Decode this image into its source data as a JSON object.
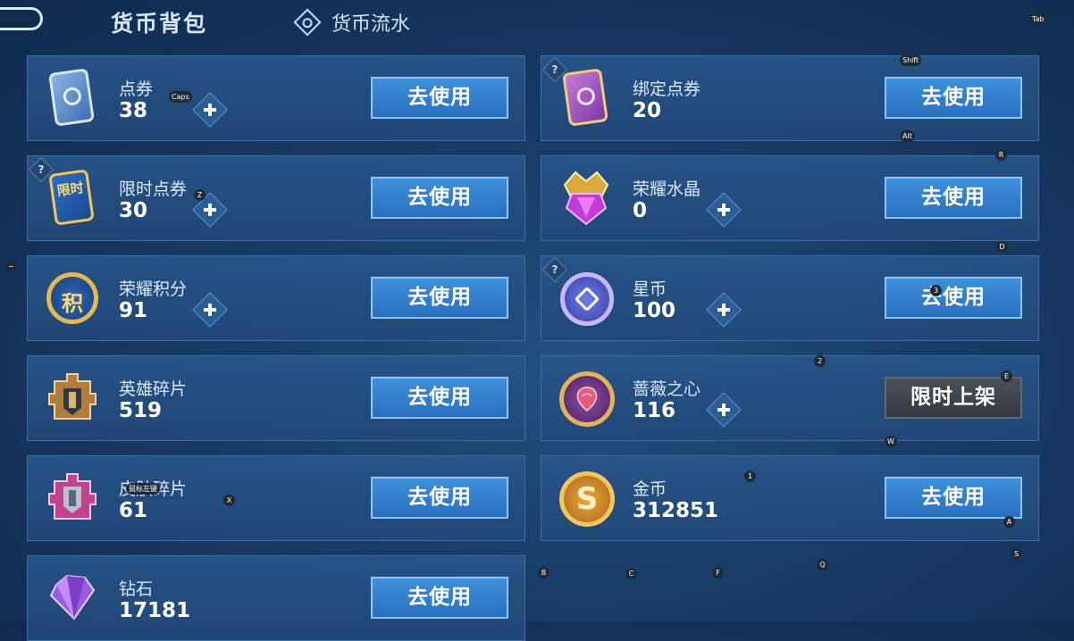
{
  "header": {
    "title": "货币背包",
    "flow_tab": "货币流水"
  },
  "currencies": [
    {
      "name": "点券",
      "amount": "38",
      "button": "去使用"
    },
    {
      "name": "绑定点券",
      "amount": "20",
      "button": "去使用"
    },
    {
      "name": "限时点券",
      "amount": "30",
      "button": "去使用"
    },
    {
      "name": "荣耀水晶",
      "amount": "0",
      "button": "去使用"
    },
    {
      "name": "荣耀积分",
      "amount": "91",
      "button": "去使用"
    },
    {
      "name": "星币",
      "amount": "100",
      "button": "去使用"
    },
    {
      "name": "英雄碎片",
      "amount": "519",
      "button": "去使用"
    },
    {
      "name": "蔷薇之心",
      "amount": "116",
      "button": "限时上架"
    },
    {
      "name": "皮肤碎片",
      "amount": "61",
      "button": "去使用"
    },
    {
      "name": "金币",
      "amount": "312851",
      "button": "去使用"
    },
    {
      "name": "钻石",
      "amount": "17181",
      "button": "去使用"
    }
  ],
  "help_glyph": "?",
  "icon_glyphs": {
    "limited": "限时",
    "points": "积",
    "gold": "S"
  },
  "key_hints": [
    "Tab",
    "Shift",
    "Alt",
    "R",
    "D",
    "3",
    "2",
    "E",
    "W",
    "1",
    "A",
    "S",
    "Q",
    "F",
    "C",
    "B",
    "X",
    "Z",
    "Caps",
    "鼠标左键",
    "−"
  ],
  "colors": {
    "button_blue": "#2f7cd0",
    "button_gray": "#3f464d",
    "card_bg": "#24507f",
    "background": "#173b66"
  }
}
